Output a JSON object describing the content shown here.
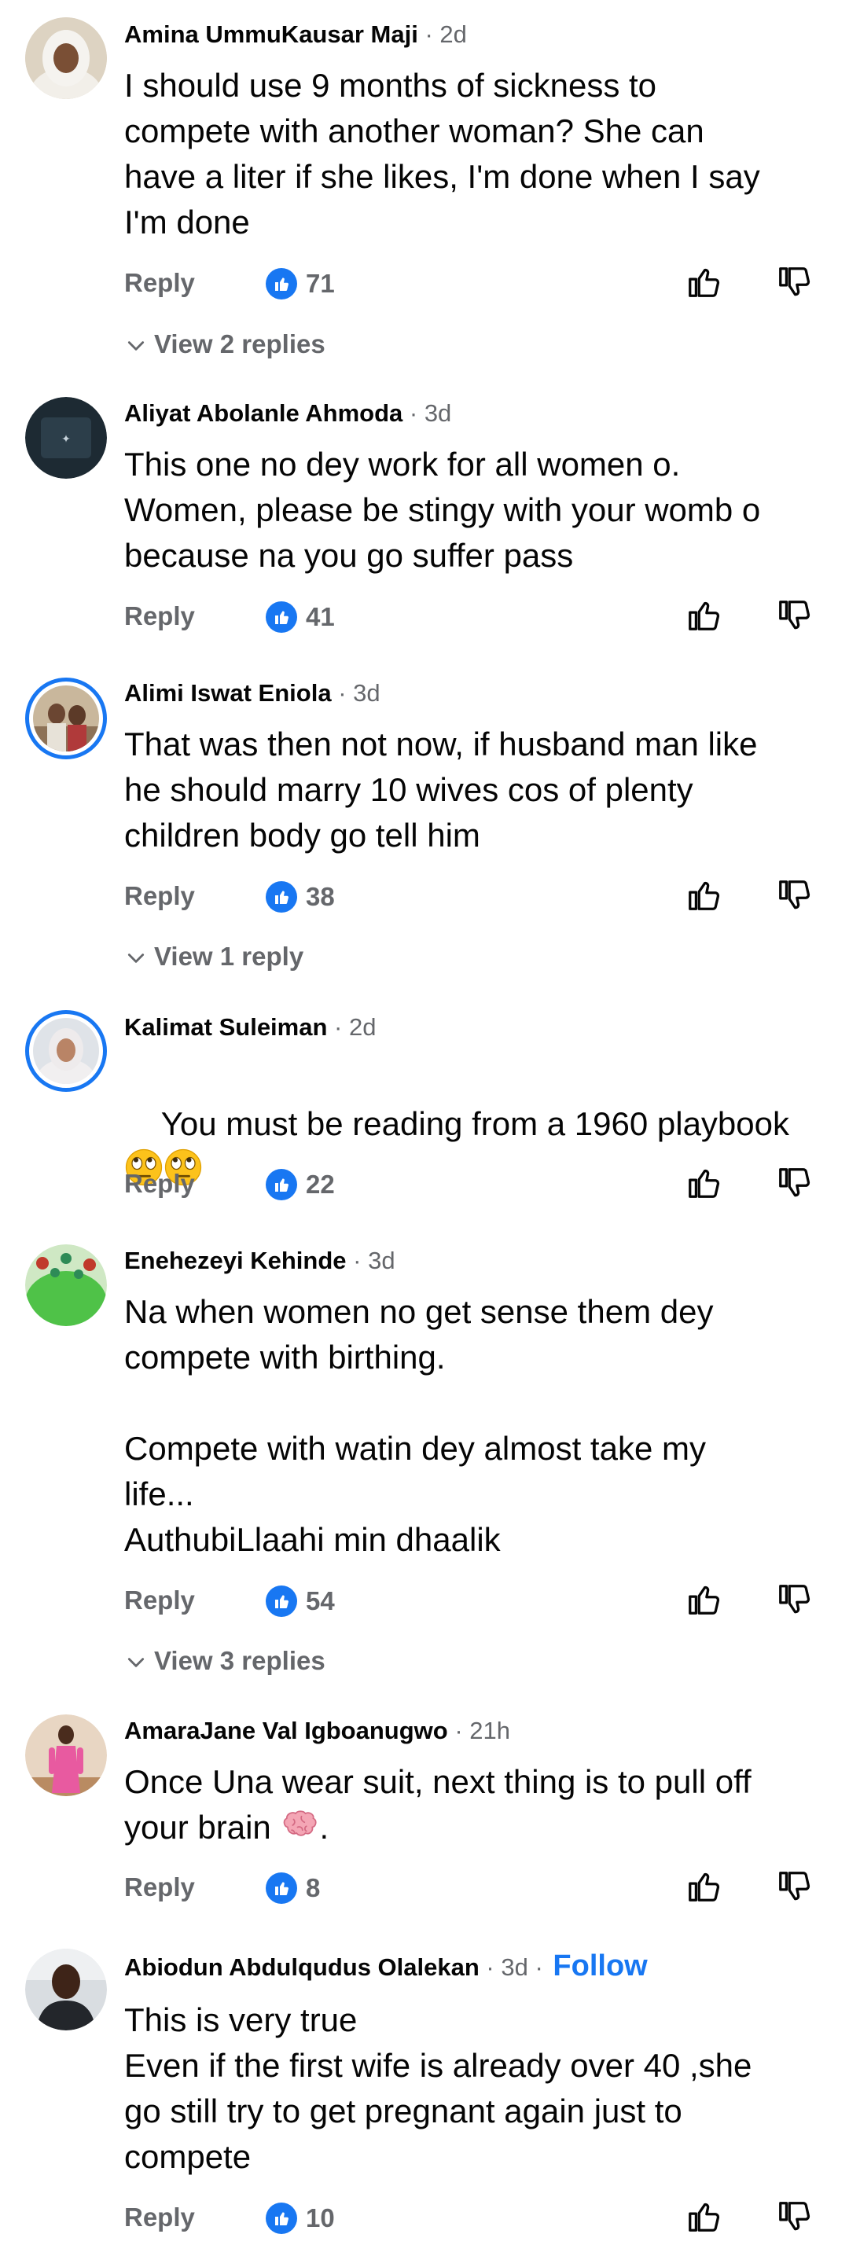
{
  "labels": {
    "reply": "Reply",
    "follow": "Follow"
  },
  "comments": [
    {
      "author": "Amina UmmuKausar Maji",
      "time": "2d",
      "text": "I should use 9 months of sickness to\ncompete with another woman? She can\nhave a liter if she likes, I'm done when I say\nI'm done",
      "likes": "71",
      "view_replies": "View 2 replies"
    },
    {
      "author": "Aliyat Abolanle Ahmoda",
      "time": "3d",
      "text": "This one no dey work for all women o.\nWomen, please be stingy with your womb o\nbecause na you go suffer pass",
      "likes": "41"
    },
    {
      "author": "Alimi Iswat Eniola",
      "time": "3d",
      "text": "That was then not now, if husband man like\nhe should marry 10 wives cos of plenty\nchildren body go tell him",
      "likes": "38",
      "view_replies": "View 1 reply"
    },
    {
      "author": "Kalimat Suleiman",
      "time": "2d",
      "text": "You must be reading from a 1960 playbook",
      "likes": "22"
    },
    {
      "author": "Enehezeyi Kehinde",
      "time": "3d",
      "text": "Na when women no get sense them dey\ncompete with birthing.\n\nCompete with watin dey almost take my\nlife...\nAuthubiLlaahi min dhaalik",
      "likes": "54",
      "view_replies": "View 3 replies"
    },
    {
      "author": "AmaraJane Val Igboanugwo",
      "time": "21h",
      "text": "Once Una wear suit, next thing is to pull off\nyour brain",
      "text_after": ".",
      "likes": "8"
    },
    {
      "author": "Abiodun Abdulqudus Olalekan",
      "time": "3d",
      "text": "This is very true\nEven if the first wife is already over 40 ,she\ngo still try to get pregnant again just to\ncompete",
      "likes": "10"
    }
  ],
  "colors": {
    "accent": "#1877f2",
    "secondary_text": "#65676b",
    "primary_text": "#050505"
  },
  "icons": [
    "like-badge-icon",
    "thumbs-up-icon",
    "thumbs-down-icon",
    "chevron-down-icon",
    "eye-roll-emoji",
    "brain-emoji"
  ]
}
